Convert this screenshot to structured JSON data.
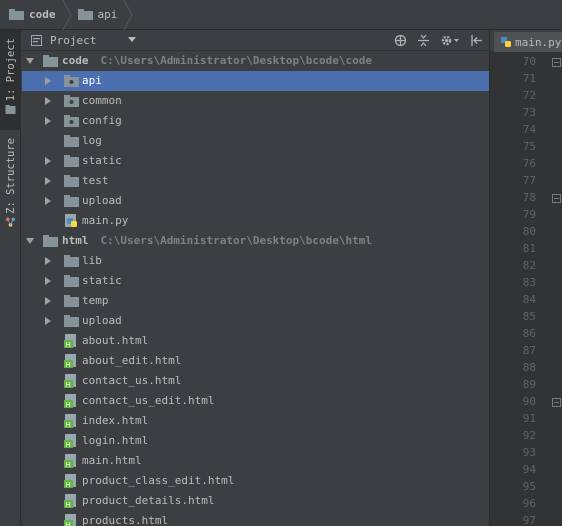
{
  "breadcrumb": [
    {
      "label": "code",
      "bold": true
    },
    {
      "label": "api",
      "bold": false
    }
  ],
  "left_strip": {
    "project_tab": "1: Project",
    "structure_tab": "Z: Structure"
  },
  "panel": {
    "view_label": "Project"
  },
  "tree": [
    {
      "label": "code",
      "path": "C:\\Users\\Administrator\\Desktop\\bcode\\code",
      "depth": 0,
      "type": "root",
      "expanded": true
    },
    {
      "label": "api",
      "depth": 1,
      "type": "pkg",
      "expandable": true,
      "selected": true
    },
    {
      "label": "common",
      "depth": 1,
      "type": "pkg",
      "expandable": true
    },
    {
      "label": "config",
      "depth": 1,
      "type": "pkg",
      "expandable": true
    },
    {
      "label": "log",
      "depth": 1,
      "type": "folder",
      "expandable": false
    },
    {
      "label": "static",
      "depth": 1,
      "type": "folder",
      "expandable": true
    },
    {
      "label": "test",
      "depth": 1,
      "type": "folder",
      "expandable": true
    },
    {
      "label": "upload",
      "depth": 1,
      "type": "folder",
      "expandable": true
    },
    {
      "label": "main.py",
      "depth": 1,
      "type": "py",
      "expandable": false
    },
    {
      "label": "html",
      "path": "C:\\Users\\Administrator\\Desktop\\bcode\\html",
      "depth": 0,
      "type": "root",
      "expanded": true
    },
    {
      "label": "lib",
      "depth": 1,
      "type": "folder",
      "expandable": true
    },
    {
      "label": "static",
      "depth": 1,
      "type": "folder",
      "expandable": true
    },
    {
      "label": "temp",
      "depth": 1,
      "type": "folder",
      "expandable": true
    },
    {
      "label": "upload",
      "depth": 1,
      "type": "folder",
      "expandable": true
    },
    {
      "label": "about.html",
      "depth": 1,
      "type": "html",
      "expandable": false
    },
    {
      "label": "about_edit.html",
      "depth": 1,
      "type": "html",
      "expandable": false
    },
    {
      "label": "contact_us.html",
      "depth": 1,
      "type": "html",
      "expandable": false
    },
    {
      "label": "contact_us_edit.html",
      "depth": 1,
      "type": "html",
      "expandable": false
    },
    {
      "label": "index.html",
      "depth": 1,
      "type": "html",
      "expandable": false
    },
    {
      "label": "login.html",
      "depth": 1,
      "type": "html",
      "expandable": false
    },
    {
      "label": "main.html",
      "depth": 1,
      "type": "html",
      "expandable": false
    },
    {
      "label": "product_class_edit.html",
      "depth": 1,
      "type": "html",
      "expandable": false
    },
    {
      "label": "product_details.html",
      "depth": 1,
      "type": "html",
      "expandable": false
    },
    {
      "label": "products.html",
      "depth": 1,
      "type": "html",
      "expandable": false
    }
  ],
  "editor": {
    "tab_label": "main.py",
    "line_numbers": [
      "70",
      "71",
      "72",
      "73",
      "74",
      "75",
      "76",
      "77",
      "78",
      "79",
      "80",
      "81",
      "82",
      "83",
      "84",
      "85",
      "86",
      "87",
      "88",
      "89",
      "90",
      "91",
      "92",
      "93",
      "94",
      "95",
      "96",
      "97"
    ],
    "fold_markers_at": [
      "70",
      "78",
      "90"
    ]
  },
  "colors": {
    "panel_bg": "#3c3f41",
    "selection": "#4b6eaf",
    "gutter_bg": "#313335",
    "text": "#bbbbbb",
    "path_text": "#808080",
    "folder_icon": "#87939a",
    "html_icon_green": "#62b543"
  }
}
